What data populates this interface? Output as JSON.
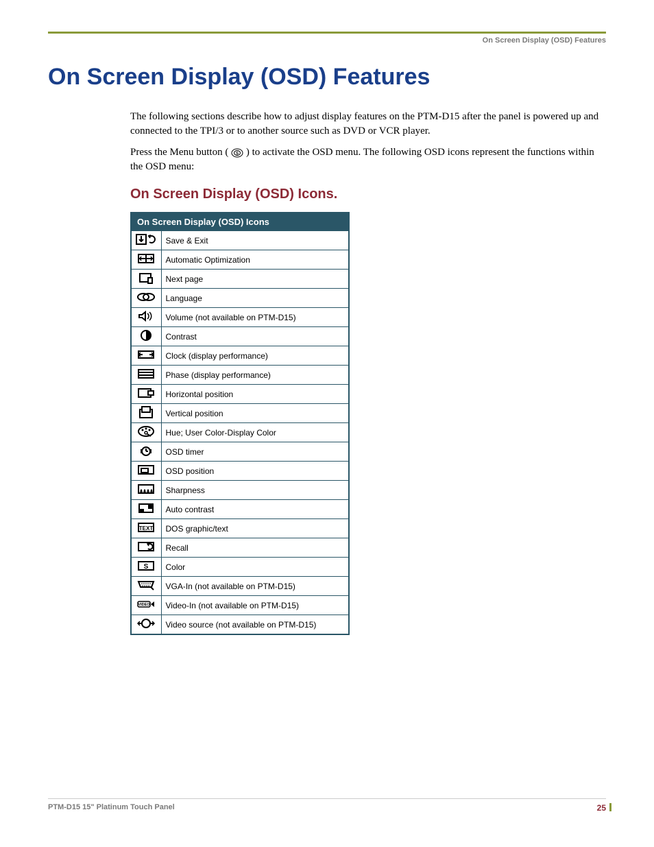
{
  "breadcrumb": "On Screen Display (OSD) Features",
  "title": "On Screen Display (OSD) Features",
  "intro_p1": "The following sections describe how to adjust display features on the PTM-D15 after the panel is powered up and connected to the TPI/3 or to another source such as DVD or VCR player.",
  "intro_p2a": "Press the Menu button (",
  "intro_p2b": ") to activate the OSD menu. The following OSD icons represent the functions within the OSD menu:",
  "section_title": "On Screen Display (OSD) Icons.",
  "table_header": "On Screen Display (OSD) Icons",
  "rows": [
    {
      "iconkey": "save-exit",
      "label": "Save & Exit"
    },
    {
      "iconkey": "auto-opt",
      "label": "Automatic Optimization"
    },
    {
      "iconkey": "next-page",
      "label": "Next page"
    },
    {
      "iconkey": "language",
      "label": "Language"
    },
    {
      "iconkey": "volume",
      "label": "Volume (not available on PTM-D15)"
    },
    {
      "iconkey": "contrast",
      "label": "Contrast"
    },
    {
      "iconkey": "clock",
      "label": "Clock (display performance)"
    },
    {
      "iconkey": "phase",
      "label": "Phase (display performance)"
    },
    {
      "iconkey": "hpos",
      "label": "Horizontal position"
    },
    {
      "iconkey": "vpos",
      "label": "Vertical position"
    },
    {
      "iconkey": "hue",
      "label": "Hue; User Color-Display Color"
    },
    {
      "iconkey": "osd-timer",
      "label": "OSD timer"
    },
    {
      "iconkey": "osd-position",
      "label": "OSD position"
    },
    {
      "iconkey": "sharpness",
      "label": "Sharpness"
    },
    {
      "iconkey": "auto-contrast",
      "label": "Auto contrast"
    },
    {
      "iconkey": "dos-text",
      "label": "DOS graphic/text"
    },
    {
      "iconkey": "recall",
      "label": "Recall"
    },
    {
      "iconkey": "color",
      "label": "Color"
    },
    {
      "iconkey": "vga-in",
      "label": "VGA-In (not available on PTM-D15)"
    },
    {
      "iconkey": "video-in",
      "label": "Video-In (not available on PTM-D15)"
    },
    {
      "iconkey": "video-source",
      "label": "Video source (not available on PTM-D15)"
    }
  ],
  "footer_text": "PTM-D15 15\" Platinum Touch Panel",
  "page_number": "25"
}
